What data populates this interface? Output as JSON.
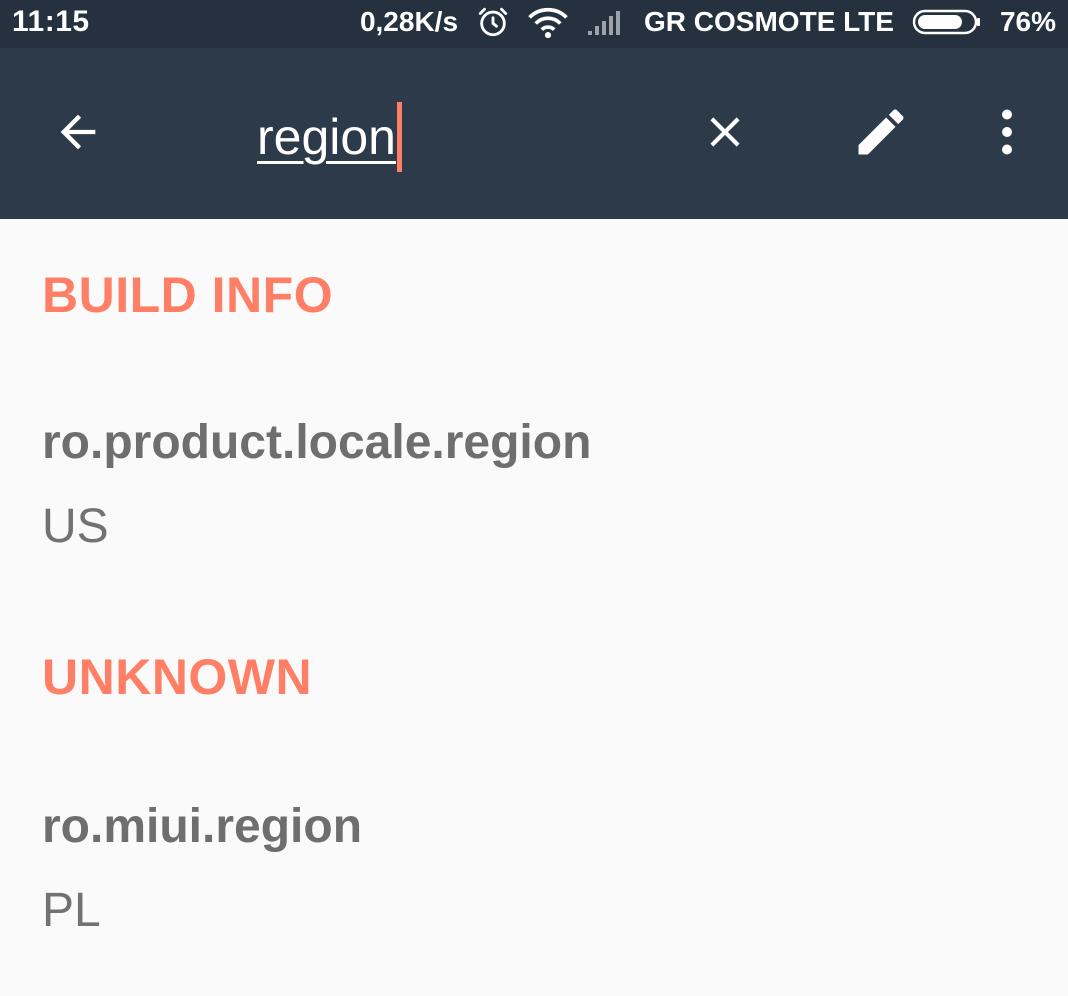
{
  "status_bar": {
    "time": "11:15",
    "network_speed": "0,28K/s",
    "carrier": "GR COSMOTE LTE",
    "battery": "76%",
    "icons": [
      "alarm-icon",
      "wifi-icon",
      "cell-signal-icon",
      "battery-icon"
    ],
    "battery_level": 0.76
  },
  "toolbar": {
    "search_query": "region",
    "icons": [
      "back-arrow-icon",
      "clear-icon",
      "edit-icon",
      "more-vert-icon"
    ],
    "accent_color": "#ff7f66",
    "background_color": "#2d3a4a"
  },
  "sections": [
    {
      "title": "BUILD INFO",
      "items": [
        {
          "key": "ro.product.locale.region",
          "value": "US"
        }
      ]
    },
    {
      "title": "UNKNOWN",
      "items": [
        {
          "key": "ro.miui.region",
          "value": "PL"
        }
      ]
    }
  ]
}
